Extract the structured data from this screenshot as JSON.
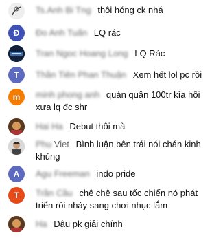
{
  "chat": {
    "messages": [
      {
        "author": "Ts.Anh Bi Tng",
        "text": "thôi hóng ck nhá",
        "avatar": {
          "type": "photo",
          "variant": "sketch"
        }
      },
      {
        "author": "Đo Anh Tuấn",
        "text": "LQ rác",
        "avatar": {
          "type": "letter",
          "letter": "Đ",
          "color": "#3f51b5"
        }
      },
      {
        "author": "Tran Ngoc Hoang Long",
        "text": "LQ Rác",
        "avatar": {
          "type": "photo",
          "variant": "dark"
        }
      },
      {
        "author": "Thần Tiên Phan Thuận",
        "text": "Xem hết lol pc rồi",
        "avatar": {
          "type": "letter",
          "letter": "T",
          "color": "#5c6bc0"
        }
      },
      {
        "author": "minh phong anh",
        "text": "quán quân 100tr kìa hồi xưa lq đc shr",
        "avatar": {
          "type": "letter",
          "letter": "m",
          "color": "#f57c00"
        }
      },
      {
        "author": "Hai Ha",
        "text": "Debut thôi mà",
        "avatar": {
          "type": "photo",
          "variant": "face"
        }
      },
      {
        "author_hidden": "Phu",
        "author_visible": "Viet",
        "text": "Bình luận bên trái nói chán kinh khủng",
        "avatar": {
          "type": "photo",
          "variant": "portrait"
        }
      },
      {
        "author": "Agu Freeman",
        "text": "indo pride",
        "avatar": {
          "type": "letter",
          "letter": "A",
          "color": "#5c6bc0"
        }
      },
      {
        "author": "Trần Cầu",
        "text": "chê chê sau tốc chiến nó phát triển rồi nhảy sang chơi nhục lắm",
        "avatar": {
          "type": "letter",
          "letter": "T",
          "color": "#e64a19"
        }
      },
      {
        "author": "Ha",
        "text": "Đâu pk giải chính",
        "avatar": {
          "type": "photo",
          "variant": "face"
        }
      }
    ]
  }
}
